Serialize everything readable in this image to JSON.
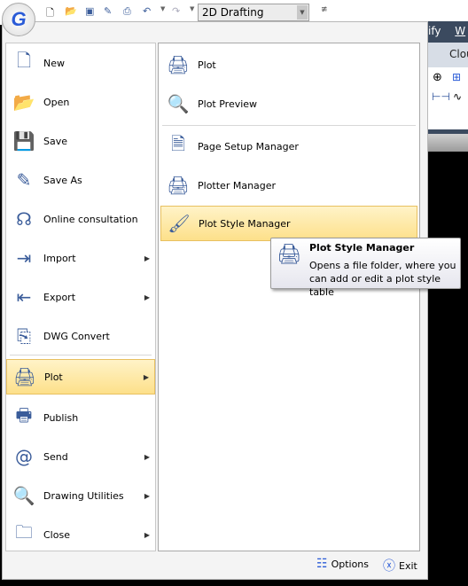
{
  "quick_access": {
    "icons": [
      "new-icon",
      "open-icon",
      "save-icon",
      "save-as-icon",
      "print-icon",
      "undo-icon",
      "redo-icon"
    ],
    "workspace": "2D Drafting"
  },
  "app_logo": "G",
  "background_ribbon": {
    "menu_fragment": "ify",
    "menu_fragment2": "W",
    "tab_fragment": "Clou"
  },
  "left_menu": [
    {
      "label": "New",
      "icon": "new-file-icon",
      "submenu": false
    },
    {
      "label": "Open",
      "icon": "open-folder-icon",
      "submenu": false
    },
    {
      "label": "Save",
      "icon": "save-icon",
      "submenu": false
    },
    {
      "label": "Save As",
      "icon": "save-as-icon",
      "submenu": false
    },
    {
      "label": "Online consultation",
      "icon": "headset-icon",
      "submenu": false
    },
    {
      "label": "Import",
      "icon": "import-icon",
      "submenu": true
    },
    {
      "label": "Export",
      "icon": "export-icon",
      "submenu": true
    },
    {
      "label": "DWG Convert",
      "icon": "dwg-convert-icon",
      "submenu": false
    },
    {
      "label": "Plot",
      "icon": "printer-icon",
      "submenu": true,
      "selected": true
    },
    {
      "label": "Publish",
      "icon": "publish-icon",
      "submenu": false
    },
    {
      "label": "Send",
      "icon": "at-icon",
      "submenu": true
    },
    {
      "label": "Drawing Utilities",
      "icon": "magnifier-icon",
      "submenu": true
    },
    {
      "label": "Close",
      "icon": "close-folder-icon",
      "submenu": true
    }
  ],
  "right_menu": [
    {
      "label": "Plot",
      "icon": "printer-icon"
    },
    {
      "label": "Plot Preview",
      "icon": "preview-icon"
    },
    {
      "label": "Page Setup Manager",
      "icon": "page-setup-icon"
    },
    {
      "label": "Plotter Manager",
      "icon": "plotter-icon"
    },
    {
      "label": "Plot Style Manager",
      "icon": "plot-style-icon",
      "selected": true
    }
  ],
  "tooltip": {
    "title": "Plot Style Manager",
    "description": "Opens a file folder, where you can add or edit a plot style table"
  },
  "footer": {
    "options": "Options",
    "exit": "Exit"
  }
}
